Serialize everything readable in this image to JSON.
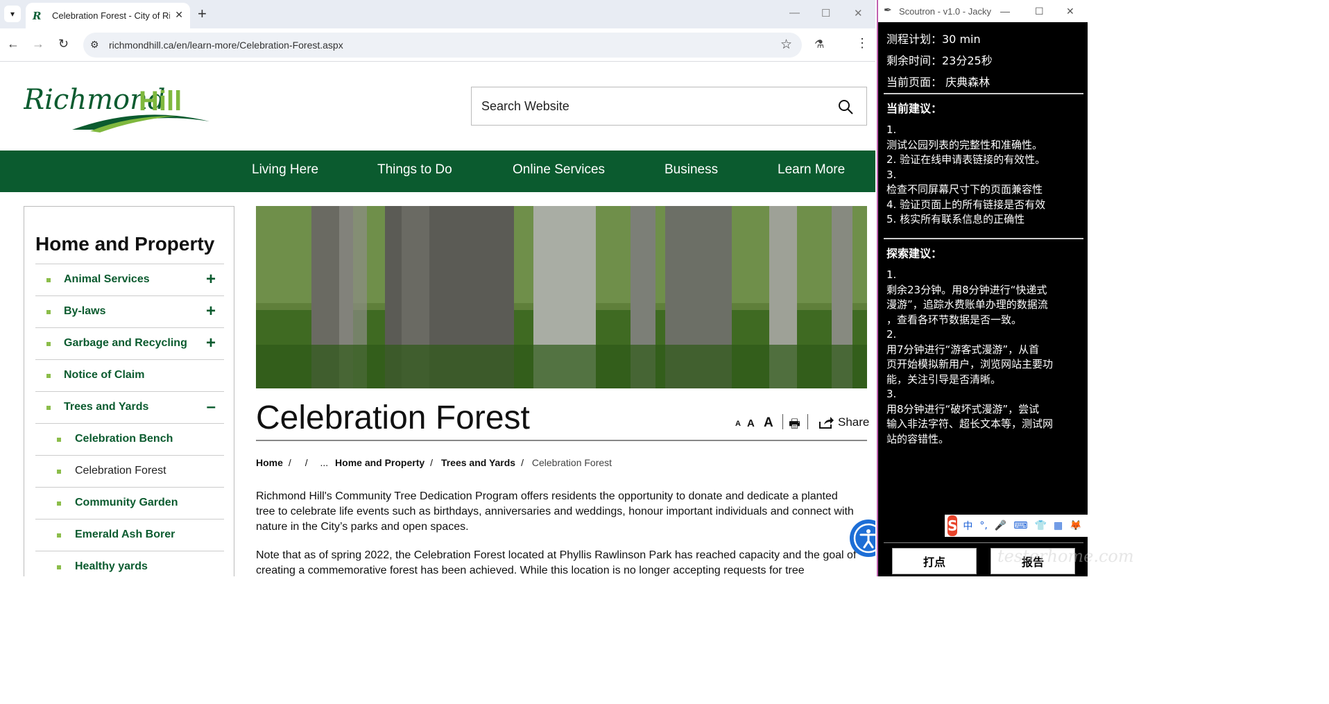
{
  "browser": {
    "tab_title": "Celebration Forest - City of Richmond Hill",
    "new_tab": "+",
    "close_tab": "✕",
    "url": "richmondhill.ca/en/learn-more/Celebration-Forest.aspx",
    "window_controls": [
      "—",
      "☐",
      "✕"
    ]
  },
  "site": {
    "logo_text_1": "Richmond",
    "logo_text_2": "Hill",
    "search_placeholder": "Search Website",
    "nav": [
      "Living Here",
      "Things to Do",
      "Online Services",
      "Business",
      "Learn More"
    ],
    "brand_color": "#0b5b2f",
    "accent_color": "#8bbd4a"
  },
  "sidebar": {
    "title": "Home and Property",
    "items": [
      {
        "label": "Animal Services",
        "toggle": "+"
      },
      {
        "label": "By-laws",
        "toggle": "+"
      },
      {
        "label": "Garbage and Recycling",
        "toggle": "+"
      },
      {
        "label": "Notice of Claim",
        "toggle": ""
      },
      {
        "label": "Trees and Yards",
        "toggle": "–"
      }
    ],
    "subitems": [
      {
        "label": "Celebration Bench"
      },
      {
        "label": "Celebration Forest"
      },
      {
        "label": "Community Garden"
      },
      {
        "label": "Emerald Ash Borer"
      },
      {
        "label": "Healthy yards"
      }
    ]
  },
  "content": {
    "title": "Celebration Forest",
    "text_sizes": [
      "A",
      "A",
      "A"
    ],
    "share_label": "Share",
    "breadcrumb": {
      "home": "Home",
      "ellipsis": "...",
      "level1": "Home and Property",
      "level2": "Trees and Yards",
      "current": "Celebration Forest"
    },
    "paragraph_1": "Richmond Hill's Community Tree Dedication Program offers residents the opportunity to donate and dedicate a planted tree to celebrate life events such as birthdays, anniversaries and weddings, honour important individuals and connect with nature in the City’s parks and open spaces.",
    "paragraph_2": "Note that as of spring 2022, the Celebration Forest located at Phyllis Rawlinson Park has reached capacity and the goal of creating a commemorative forest has been achieved. While this location is no longer accepting requests for tree"
  },
  "scoutron": {
    "window_title": "Scoutron - v1.0 - Jacky",
    "plan": "测程计划：30 min",
    "remaining": "剩余时间：23分25秒",
    "current_page": "当前页面： 庆典森林",
    "current_suggestions_head": "当前建议：",
    "current_suggestions": [
      "1.",
      "测试公园列表的完整性和准确性。",
      "2.  验证在线申请表链接的有效性。",
      "3.",
      "检查不同屏幕尺寸下的页面兼容性",
      "4.  验证页面上的所有链接是否有效",
      "5.  核实所有联系信息的正确性"
    ],
    "explore_head": "探索建议：",
    "explore_suggestions": [
      "1.",
      "剩余23分钟。用8分钟进行“快递式",
      "漫游”，追踪水费账单办理的数据流",
      "，查看各环节数据是否一致。",
      "2.",
      "用7分钟进行“游客式漫游”，从首",
      "页开始模拟新用户，浏览网站主要功",
      "能，关注引导是否清晰。",
      "3.",
      "用8分钟进行“破坏式漫游”，尝试",
      "输入非法字符、超长文本等，测试网",
      "站的容错性。"
    ],
    "button_mark": "打点",
    "button_report": "报告",
    "ime_logo": "S",
    "ime_items": [
      "中",
      "°,",
      "🎤",
      "⌨",
      "👕",
      "▦",
      "🦊"
    ],
    "watermark": "testerhome.com"
  }
}
